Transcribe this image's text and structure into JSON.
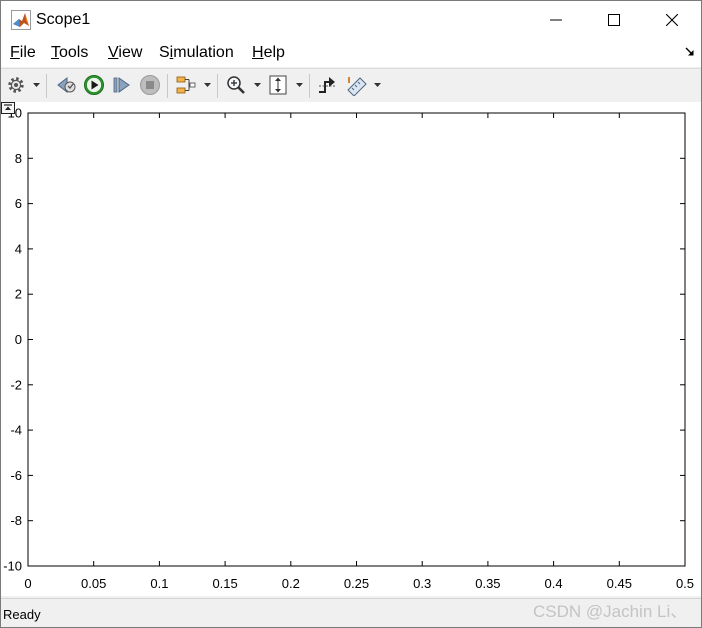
{
  "window": {
    "title": "Scope1",
    "controls": [
      "minimize-icon",
      "maximize-icon",
      "close-icon"
    ]
  },
  "menu": {
    "items": [
      {
        "label": "File",
        "hotkey": "F"
      },
      {
        "label": "Tools",
        "hotkey": "T"
      },
      {
        "label": "View",
        "hotkey": "V"
      },
      {
        "label": "Simulation",
        "hotkey": "i"
      },
      {
        "label": "Help",
        "hotkey": "H"
      }
    ]
  },
  "toolbar": {
    "buttons": [
      {
        "icon": "gear-icon",
        "dropdown": true
      },
      {
        "icon": "step-back-icon"
      },
      {
        "icon": "run-icon",
        "color": "#2e9e2e"
      },
      {
        "icon": "step-forward-icon"
      },
      {
        "icon": "stop-icon",
        "state": "disabled"
      },
      {
        "icon": "signal-selector-icon",
        "dropdown": true
      },
      {
        "icon": "zoom-in-icon",
        "dropdown": true
      },
      {
        "icon": "scale-axes-icon",
        "dropdown": true
      },
      {
        "icon": "triggers-icon"
      },
      {
        "icon": "measurements-icon",
        "dropdown": true
      }
    ]
  },
  "chart_data": {
    "type": "line",
    "series": [],
    "xlim": [
      0,
      0.5
    ],
    "ylim": [
      -10,
      10
    ],
    "x_ticks": [
      "0",
      "0.05",
      "0.1",
      "0.15",
      "0.2",
      "0.25",
      "0.3",
      "0.35",
      "0.4",
      "0.45",
      "0.5"
    ],
    "y_ticks": [
      "10",
      "8",
      "6",
      "4",
      "2",
      "0",
      "-2",
      "-4",
      "-6",
      "-8",
      "-10"
    ],
    "grid": false,
    "background": "#ffffff",
    "axis_color": "#000000"
  },
  "status": {
    "text": "Ready",
    "watermark": "CSDN @Jachin Li、"
  }
}
